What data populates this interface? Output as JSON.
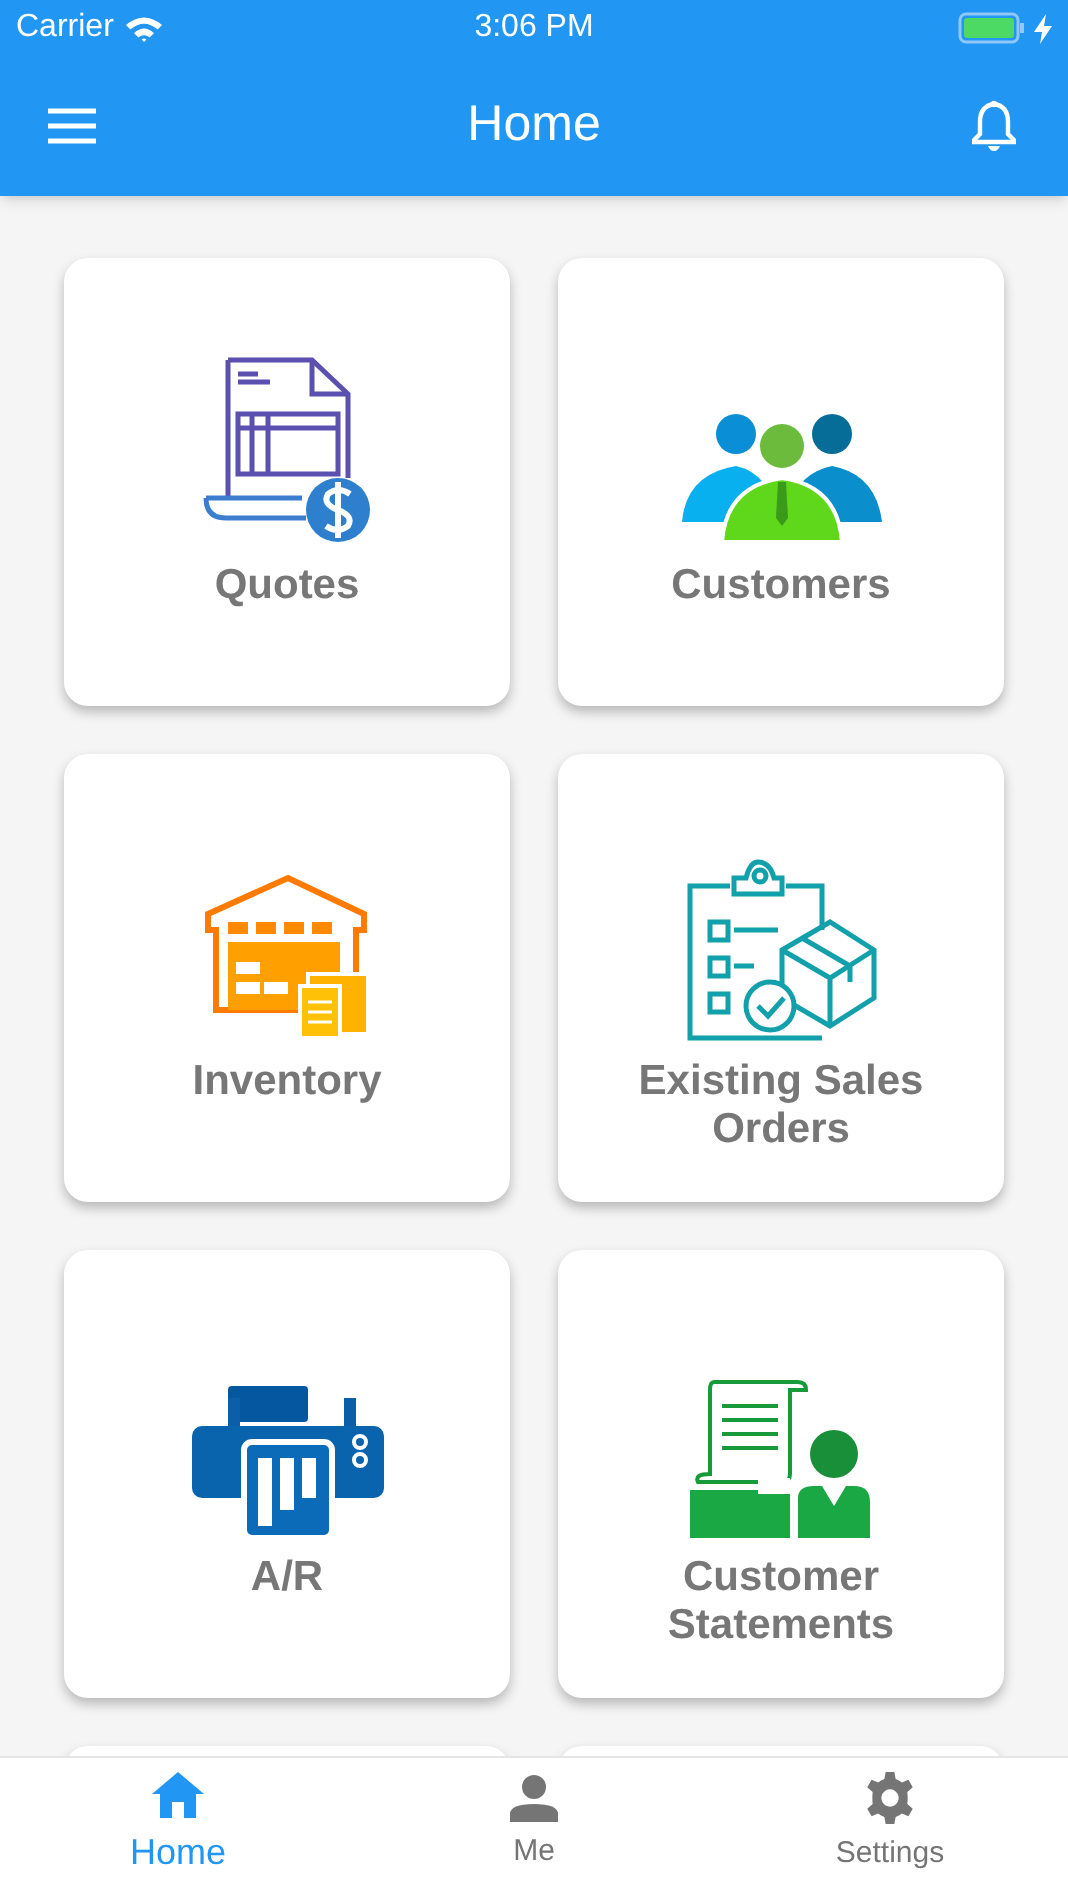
{
  "status_bar": {
    "carrier": "Carrier",
    "time": "3:06 PM"
  },
  "header": {
    "title": "Home"
  },
  "tiles": [
    {
      "kind": "quotes",
      "label": "Quotes"
    },
    {
      "kind": "customers",
      "label": "Customers"
    },
    {
      "kind": "inventory",
      "label": "Inventory"
    },
    {
      "kind": "orders",
      "label": "Existing Sales Orders"
    },
    {
      "kind": "ar",
      "label": "A/R"
    },
    {
      "kind": "statements",
      "label": "Customer Statements"
    }
  ],
  "tab_bar": [
    {
      "kind": "home",
      "label": "Home",
      "selected": true
    },
    {
      "kind": "me",
      "label": "Me",
      "selected": false
    },
    {
      "kind": "settings",
      "label": "Settings",
      "selected": false
    }
  ]
}
